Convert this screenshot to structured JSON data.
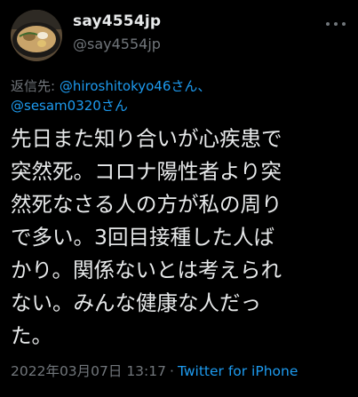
{
  "author": {
    "display_name": "say4554jp",
    "handle": "@say4554jp"
  },
  "reply": {
    "prefix": "返信先: ",
    "mention1": "@hiroshitokyo46さん、",
    "mention2": "@sesam0320さん"
  },
  "tweet": {
    "lines": [
      "先日また知り合いが心疾患で",
      "突然死。コロナ陽性者より突",
      "然死なさる人の方が私の周り",
      "で多い。3回目接種した人ば",
      "かり。関係ないとは考えられ",
      "ない。みんな健康な人だっ",
      "た。"
    ],
    "timestamp": "2022年03月07日 13:17",
    "separator": "·",
    "source": "Twitter for iPhone"
  },
  "icons": {
    "avatar": "avatar-food-bowl",
    "more": "more-options-icon"
  },
  "colors": {
    "background": "#000000",
    "text": "#e7e9ea",
    "muted": "#71767b",
    "link": "#1d9bf0"
  }
}
